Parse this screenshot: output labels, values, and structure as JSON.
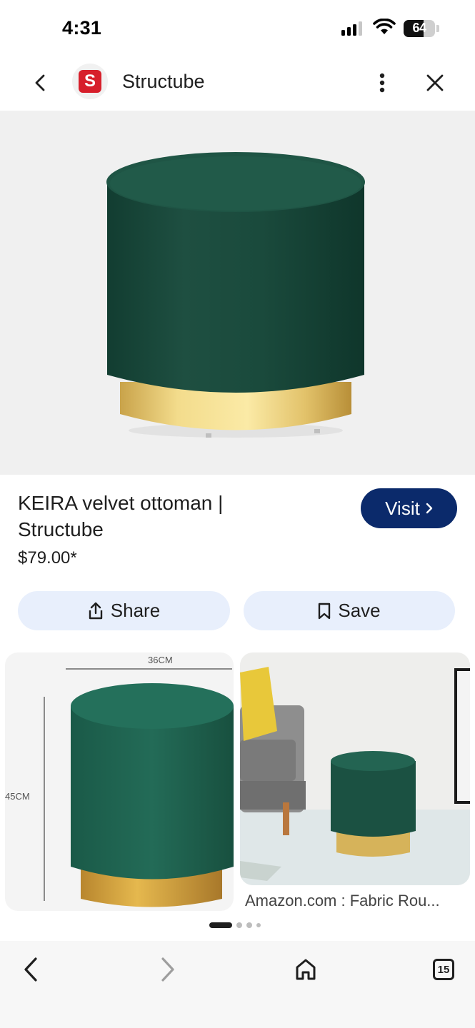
{
  "status_bar": {
    "time": "4:31",
    "battery_percent": "64",
    "battery_level": 0.64,
    "signal_bars_active": 3,
    "signal_bars_total": 4
  },
  "header": {
    "site_logo_letter": "S",
    "site_name": "Structube",
    "icons": [
      "back-arrow-icon",
      "more-vert-icon",
      "close-icon"
    ]
  },
  "product": {
    "title": "KEIRA velvet ottoman | Structube",
    "price": "$79.00*",
    "visit_label": "Visit",
    "share_label": "Share",
    "save_label": "Save"
  },
  "related": {
    "items": [
      {
        "dim_width": "36CM",
        "dim_height": "45CM"
      },
      {
        "caption": "Amazon.com : Fabric Rou..."
      }
    ],
    "carousel_pages": 4,
    "carousel_active": 0
  },
  "bottom_nav": {
    "tabs_count": "15",
    "icons": [
      "back-icon",
      "forward-icon",
      "home-icon",
      "tabs-icon"
    ]
  },
  "colors": {
    "visit_button": "#0b2a6b",
    "action_button_bg": "#e8effc",
    "brand_red": "#d71f2b",
    "velvet_green": "#1c4a3c",
    "brass_gold": "#e0c066"
  }
}
